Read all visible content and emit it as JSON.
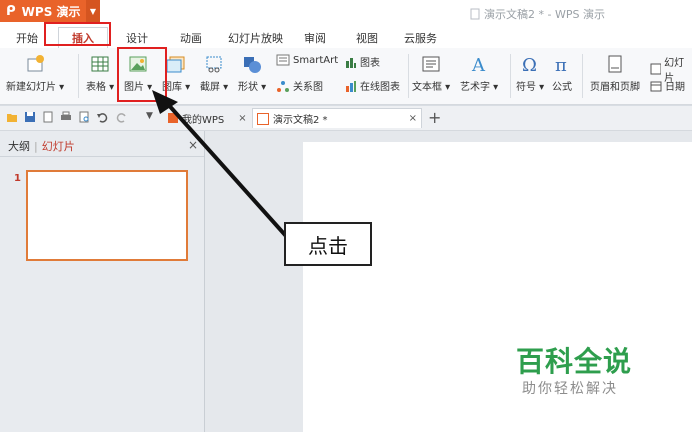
{
  "app": {
    "name": "WPS 演示",
    "doc_title": "演示文稿2 * - WPS 演示"
  },
  "tabs": [
    "开始",
    "插入",
    "设计",
    "动画",
    "幻灯片放映",
    "审阅",
    "视图",
    "云服务"
  ],
  "active_tab": "插入",
  "ribbon": {
    "new_slide": "新建幻灯片",
    "table": "表格",
    "picture": "图片",
    "gallery": "图库",
    "screenshot": "截屏",
    "shapes": "形状",
    "smartart": "SmartArt",
    "chart": "图表",
    "relation": "关系图",
    "online_chart": "在线图表",
    "textbox": "文本框",
    "wordart": "艺术字",
    "symbol": "符号",
    "formula": "公式",
    "header_footer": "页眉和页脚",
    "slide_num": "幻灯片",
    "date": "日期"
  },
  "doc_tabs": {
    "mywps": "我的WPS",
    "doc": "演示文稿2 *"
  },
  "panel": {
    "outline": "大纲",
    "sep": "|",
    "slides": "幻灯片",
    "slide_number": "1"
  },
  "annotation": {
    "callout": "点击"
  },
  "watermark": {
    "title": "百科全说",
    "subtitle": "助你轻松解决"
  },
  "colors": {
    "brand": "#e9632a",
    "highlight": "#e02020",
    "watermark": "#2e9e4d"
  }
}
